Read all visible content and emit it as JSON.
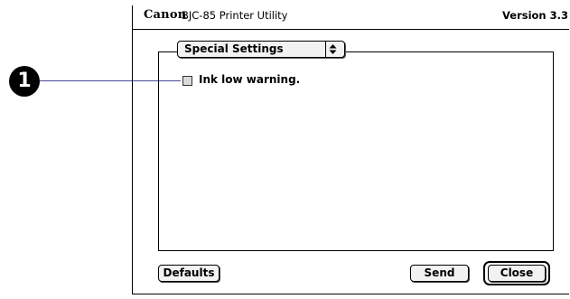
{
  "callout": {
    "number": "1"
  },
  "window": {
    "brand": "Canon",
    "title": "BJC-85 Printer Utility",
    "version": "Version 3.3"
  },
  "panel": {
    "popup": {
      "selected": "Special Settings",
      "arrows_icon": "up-down-arrows-icon"
    },
    "checkbox": {
      "label": "Ink low warning.",
      "checked": false
    }
  },
  "buttons": {
    "defaults": "Defaults",
    "send": "Send",
    "close": "Close"
  }
}
